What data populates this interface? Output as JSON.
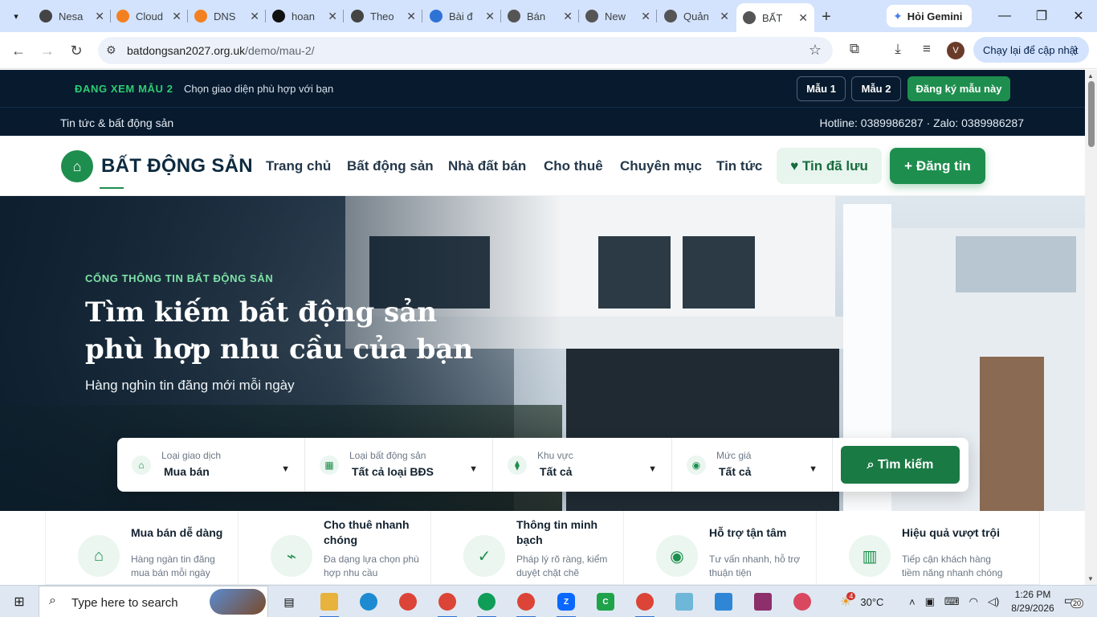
{
  "browser": {
    "tabs": [
      {
        "title": "Nesa",
        "icon": "openai-icon",
        "color": "#444"
      },
      {
        "title": "Cloud",
        "icon": "cloudflare-icon",
        "color": "#f38020"
      },
      {
        "title": "DNS",
        "icon": "cloudflare-icon",
        "color": "#f38020"
      },
      {
        "title": "hoan",
        "icon": "github-icon",
        "color": "#111"
      },
      {
        "title": "Theo",
        "icon": "openai-icon",
        "color": "#444"
      },
      {
        "title": "Bài đ",
        "icon": "flag-icon",
        "color": "#2f72d6"
      },
      {
        "title": "Bán ",
        "icon": "shoe-icon",
        "color": "#555"
      },
      {
        "title": "New",
        "icon": "globe-icon",
        "color": "#555"
      },
      {
        "title": "Quản",
        "icon": "globe-icon",
        "color": "#555"
      },
      {
        "title": "BẤT ",
        "icon": "globe-icon",
        "color": "#555"
      }
    ],
    "gemini_label": "Hỏi Gemini",
    "url_host": "batdongsan2027.org.uk",
    "url_path": "/demo/mau-2/",
    "profile_initial": "V",
    "update_label": "Chạy lại để cập nhật"
  },
  "demobar": {
    "label": "ĐANG XEM MẪU 2",
    "desc": "Chọn giao diện phù hợp với bạn",
    "btn_mau1": "Mẫu 1",
    "btn_mau2": "Mẫu 2",
    "btn_register": "Đăng ký mẫu này"
  },
  "infobar": {
    "left": "Tin tức & bất động sản",
    "right": "Hotline: 0389986287 · Zalo: 0389986287"
  },
  "header": {
    "logo_icon": "⌂",
    "logo_text": "BẤT ĐỘNG SẢN",
    "nav": [
      "Trang chủ",
      "Bất động sản",
      "Nhà đất bán",
      "Cho thuê",
      "Chuyên mục",
      "Tin tức"
    ],
    "saved_label": "♥ Tin đã lưu",
    "post_label": "+ Đăng tin"
  },
  "hero": {
    "kicker": "CỔNG THÔNG TIN BẤT ĐỘNG SẢN",
    "title_line1": "Tìm kiếm bất động sản",
    "title_line2": "phù hợp nhu cầu của bạn",
    "subtitle": "Hàng nghìn tin đăng mới mỗi ngày"
  },
  "search": {
    "fields": [
      {
        "label": "Loại giao dịch",
        "value": "Mua bán",
        "icon": "⌂",
        "icon_name": "home-icon"
      },
      {
        "label": "Loại bất động sản",
        "value": "Tất cả loại BĐS",
        "icon": "▦",
        "icon_name": "building-icon"
      },
      {
        "label": "Khu vực",
        "value": "Tất cả",
        "icon": "⧫",
        "icon_name": "location-icon"
      },
      {
        "label": "Mức giá",
        "value": "Tất cả",
        "icon": "◉",
        "icon_name": "price-icon"
      }
    ],
    "button_label": "⌕ Tìm kiếm"
  },
  "features": [
    {
      "title": "Mua bán dễ dàng",
      "desc": "Hàng ngàn tin đăng mua bán mỗi ngày",
      "icon": "⌂",
      "icon_name": "home-icon"
    },
    {
      "title": "Cho thuê nhanh chóng",
      "desc": "Đa dạng lựa chọn phù hợp nhu cầu",
      "icon": "⌁",
      "icon_name": "key-icon"
    },
    {
      "title": "Thông tin minh bạch",
      "desc": "Pháp lý rõ ràng, kiểm duyệt chặt chẽ",
      "icon": "✓",
      "icon_name": "check-icon"
    },
    {
      "title": "Hỗ trợ tận tâm",
      "desc": "Tư vấn nhanh, hỗ trợ thuận tiện",
      "icon": "◉",
      "icon_name": "support-icon"
    },
    {
      "title": "Hiệu quả vượt trội",
      "desc": "Tiếp cận khách hàng tiềm năng nhanh chóng",
      "icon": "▥",
      "icon_name": "chart-icon"
    }
  ],
  "taskbar": {
    "search_placeholder": "Type here to search",
    "weather": "30°C",
    "weather_badge": "4",
    "time": "1:26 PM",
    "date": "8/29/2026",
    "notif_count": "20"
  },
  "colors": {
    "brand_green": "#1e8e4e",
    "dark_navy": "#071a2e",
    "accent_light_green": "#7fe3a7"
  }
}
